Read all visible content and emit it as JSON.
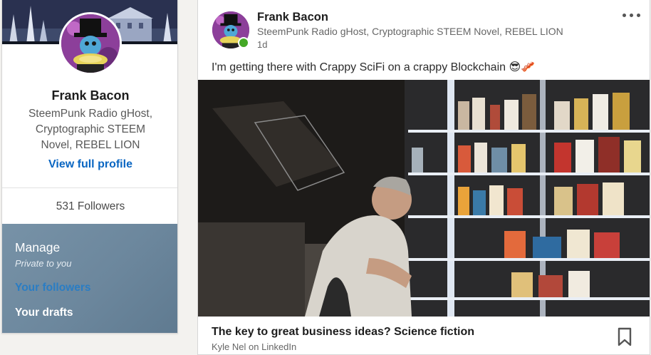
{
  "profile": {
    "name": "Frank Bacon",
    "headline": "SteemPunk Radio gHost, Cryptographic STEEM Novel, REBEL LION",
    "view_profile": "View full profile",
    "followers": "531 Followers",
    "avatar_icon": "steampunk-portrait-avatar"
  },
  "manage": {
    "title": "Manage",
    "subtitle": "Private to you",
    "followers_link": "Your followers",
    "drafts_link": "Your drafts"
  },
  "post": {
    "author_name": "Frank Bacon",
    "author_headline": "SteemPunk Radio gHost, Cryptographic STEEM Novel, REBEL LION",
    "time": "1d",
    "text": "I'm getting there with Crappy SciFi on a crappy Blockchain 😎🥓",
    "more_icon": "ellipsis-icon",
    "link": {
      "title": "The key to great business ideas? Science fiction",
      "source": "Kyle Nel on LinkedIn"
    },
    "bookmark_icon": "bookmark-icon"
  },
  "colors": {
    "link_blue": "#0a66c2",
    "panel_slate": "#6c879d",
    "online_green": "#44a826",
    "page_bg": "#f3f2ef"
  }
}
